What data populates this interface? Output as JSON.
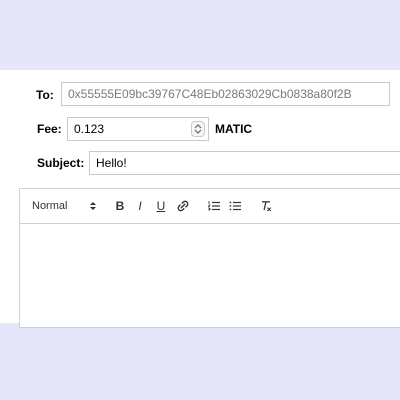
{
  "form": {
    "to_label": "To:",
    "to_value": "0x55555E09bc39767C48Eb02863029Cb0838a80f2B",
    "fee_label": "Fee:",
    "fee_value": "0.123",
    "fee_unit": "MATIC",
    "subject_label": "Subject:",
    "subject_value": "Hello!"
  },
  "editor": {
    "format_select_value": "Normal",
    "toolbar": {
      "bold_label": "B",
      "italic_label": "I",
      "underline_label": "U"
    },
    "content_text": ""
  },
  "icons": {
    "spinner": "spinner-icon",
    "select_caret": "caret-up-down-icon",
    "link": "link-icon",
    "ordered_list": "ordered-list-icon",
    "bullet_list": "bullet-list-icon",
    "clear_format": "clear-format-icon"
  },
  "colors": {
    "page_background": "#e6e6fa",
    "panel_background": "#ffffff",
    "border": "#c9c9c9",
    "placeholder_text": "#7a7a7a"
  }
}
